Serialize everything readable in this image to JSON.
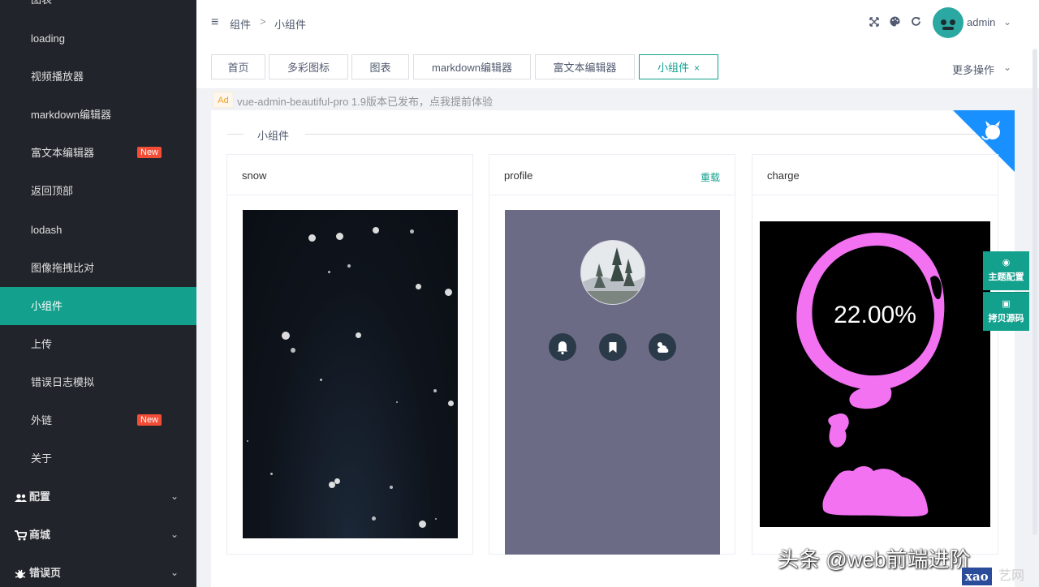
{
  "sidebar": {
    "items": [
      {
        "label": "图表"
      },
      {
        "label": "loading"
      },
      {
        "label": "视频播放器"
      },
      {
        "label": "markdown编辑器"
      },
      {
        "label": "富文本编辑器",
        "badge": "New"
      },
      {
        "label": "返回顶部"
      },
      {
        "label": "lodash"
      },
      {
        "label": "图像拖拽比对"
      },
      {
        "label": "小组件",
        "active": true
      },
      {
        "label": "上传"
      },
      {
        "label": "错误日志模拟"
      },
      {
        "label": "外链",
        "badge": "New"
      },
      {
        "label": "关于"
      }
    ],
    "groups": [
      {
        "label": "配置",
        "icon": "users-cog-icon"
      },
      {
        "label": "商城",
        "icon": "shopping-cart-icon"
      },
      {
        "label": "错误页",
        "icon": "bug-icon"
      }
    ]
  },
  "header": {
    "breadcrumb": [
      "组件",
      "小组件"
    ],
    "username": "admin"
  },
  "tabs": [
    {
      "label": "首页"
    },
    {
      "label": "多彩图标"
    },
    {
      "label": "图表"
    },
    {
      "label": "markdown编辑器"
    },
    {
      "label": "富文本编辑器"
    },
    {
      "label": "小组件",
      "active": true
    }
  ],
  "more_ops": "更多操作",
  "ad": {
    "tag": "Ad",
    "text": "vue-admin-beautiful-pro 1.9版本已发布，点我提前体验"
  },
  "section_title": "小组件",
  "cards": {
    "snow": {
      "title": "snow"
    },
    "profile": {
      "title": "profile",
      "action": "重载"
    },
    "charge": {
      "title": "charge",
      "value": "22.00%"
    }
  },
  "float_panel": {
    "theme": "主题配置",
    "copy": "拷贝源码"
  },
  "watermark": {
    "text": "头条 @web前端进阶",
    "logo": "xao",
    "logo2": "艺网"
  },
  "colors": {
    "sidebar_bg": "#21252b",
    "accent": "#13a08d",
    "badge": "#f34d37",
    "charge_pink": "#f372f2"
  }
}
